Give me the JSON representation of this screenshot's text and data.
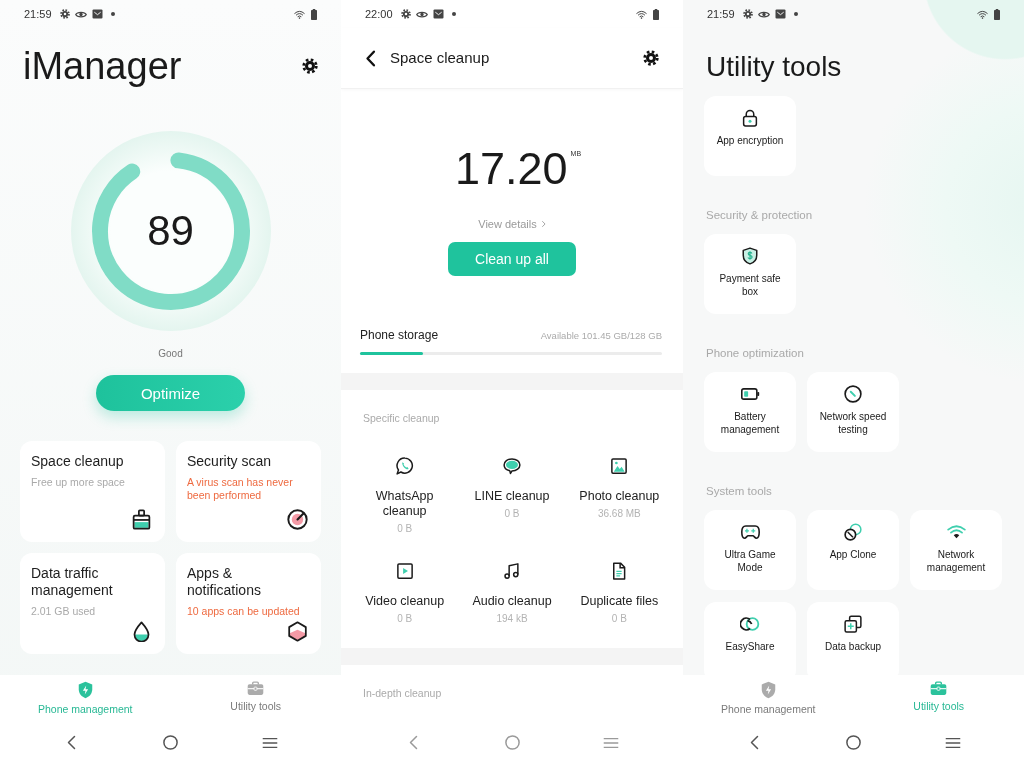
{
  "screens": [
    {
      "kind": "home",
      "status_bar": {
        "time": "21:59"
      },
      "title": "iManager",
      "score": {
        "value": "89",
        "level": 0.89,
        "label": "Good"
      },
      "primary_button": "Optimize",
      "cards": [
        {
          "title": "Space cleanup",
          "subtitle": "Free up more space",
          "warning": false
        },
        {
          "title": "Security scan",
          "subtitle": "A virus scan has never been performed",
          "warning": true
        },
        {
          "title": "Data traffic management",
          "subtitle": "2.01 GB used",
          "warning": false
        },
        {
          "title": "Apps & notifications",
          "subtitle": "10 apps can be updated",
          "warning": true
        }
      ],
      "bottom_tabs": [
        {
          "label": "Phone management",
          "selected": true
        },
        {
          "label": "Utility tools",
          "selected": false
        }
      ]
    },
    {
      "kind": "cleanup",
      "status_bar": {
        "time": "22:00"
      },
      "header": {
        "title": "Space cleanup"
      },
      "junk_size": {
        "value": "17.20",
        "unit": "MB"
      },
      "details_link": "View details",
      "primary_button": "Clean up all",
      "storage": {
        "label": "Phone storage",
        "reading": "Available 101.45 GB/128 GB",
        "level": 0.21
      },
      "sections": [
        {
          "title": "Specific cleanup",
          "items": [
            {
              "label": "WhatsApp cleanup",
              "size": "0 B"
            },
            {
              "label": "LINE cleanup",
              "size": "0 B"
            },
            {
              "label": "Photo cleanup",
              "size": "36.68 MB"
            },
            {
              "label": "Video cleanup",
              "size": "0 B"
            },
            {
              "label": "Audio cleanup",
              "size": "194 kB"
            },
            {
              "label": "Duplicate files",
              "size": "0 B"
            }
          ]
        },
        {
          "title": "In-depth cleanup"
        }
      ]
    },
    {
      "kind": "tools",
      "status_bar": {
        "time": "21:59"
      },
      "title": "Utility tools",
      "groups": [
        {
          "tiles": [
            "App encryption"
          ]
        },
        {
          "title": "Security & protection",
          "tiles": [
            "Payment safe box"
          ]
        },
        {
          "title": "Phone optimization",
          "tiles": [
            "Battery management",
            "Network speed testing"
          ]
        },
        {
          "title": "System tools",
          "tiles": [
            "Ultra Game Mode",
            "App Clone",
            "Network management",
            "EasyShare",
            "Data backup"
          ]
        }
      ],
      "bottom_tabs": [
        {
          "label": "Phone management",
          "selected": false
        },
        {
          "label": "Utility tools",
          "selected": true
        }
      ]
    }
  ]
}
